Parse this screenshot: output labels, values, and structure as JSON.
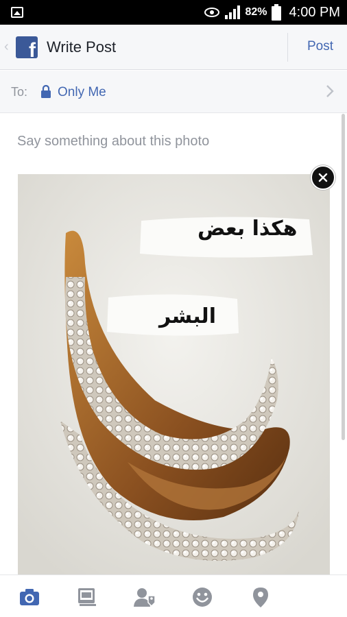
{
  "status_bar": {
    "battery_percent": "82%",
    "time": "4:00 PM",
    "icons": [
      "image-notification-icon",
      "eye-icon",
      "signal-icon",
      "battery-icon"
    ]
  },
  "header": {
    "back_glyph": "‹",
    "logo_letter": "f",
    "title": "Write Post",
    "post_label": "Post"
  },
  "audience": {
    "to_label": "To:",
    "privacy_value": "Only Me"
  },
  "composer": {
    "placeholder": "Say something about this photo"
  },
  "photo": {
    "text_line1": "هكذا بعض",
    "text_line2": "البشر"
  },
  "toolbar": {
    "items": [
      "camera-icon",
      "album-icon",
      "tag-people-icon",
      "feeling-icon",
      "location-icon"
    ]
  },
  "colors": {
    "accent": "#4267b2",
    "facebook_blue": "#3b5998",
    "active_tool": "#4267b2",
    "inactive_tool": "#90949c"
  }
}
